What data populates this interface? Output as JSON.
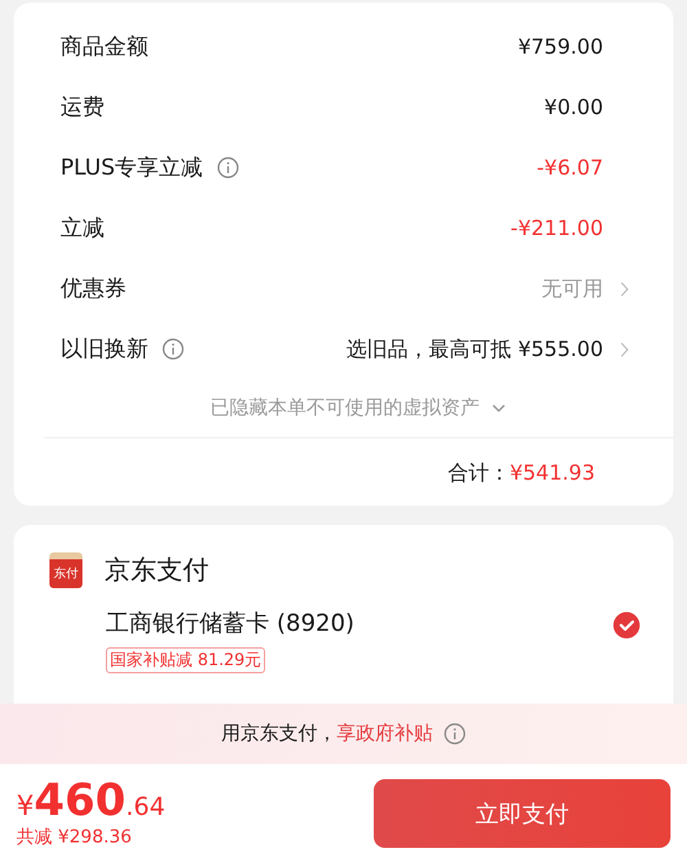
{
  "summary": {
    "rows": [
      {
        "label": "商品金额",
        "info": false,
        "value": "¥759.00",
        "kind": "normal",
        "chevron": false
      },
      {
        "label": "运费",
        "info": false,
        "value": "¥0.00",
        "kind": "normal",
        "chevron": false
      },
      {
        "label": "PLUS专享立减",
        "info": true,
        "value": "-¥6.07",
        "kind": "discount",
        "chevron": false
      },
      {
        "label": "立减",
        "info": false,
        "value": "-¥211.00",
        "kind": "discount",
        "chevron": false
      },
      {
        "label": "优惠券",
        "info": false,
        "value": "无可用",
        "kind": "muted",
        "chevron": true
      },
      {
        "label": "以旧换新",
        "info": true,
        "value": "选旧品，最高可抵 ¥555.00",
        "kind": "normal",
        "chevron": true
      }
    ],
    "hidden_assets": "已隐藏本单不可使用的虚拟资产",
    "total_label": "合计：",
    "total_value": "¥541.93"
  },
  "payment": {
    "logo_text": "东付",
    "title": "京东支付",
    "method": "工商银行储蓄卡 (8920)",
    "selected": true,
    "subsidy_tag": "国家补贴减 81.29元"
  },
  "banner": {
    "text": "用京东支付，",
    "highlight": "享政府补贴"
  },
  "footer": {
    "currency": "¥",
    "amount_int": "460",
    "amount_dec": ".64",
    "saved": "共减 ¥298.36",
    "pay_button": "立即支付"
  }
}
